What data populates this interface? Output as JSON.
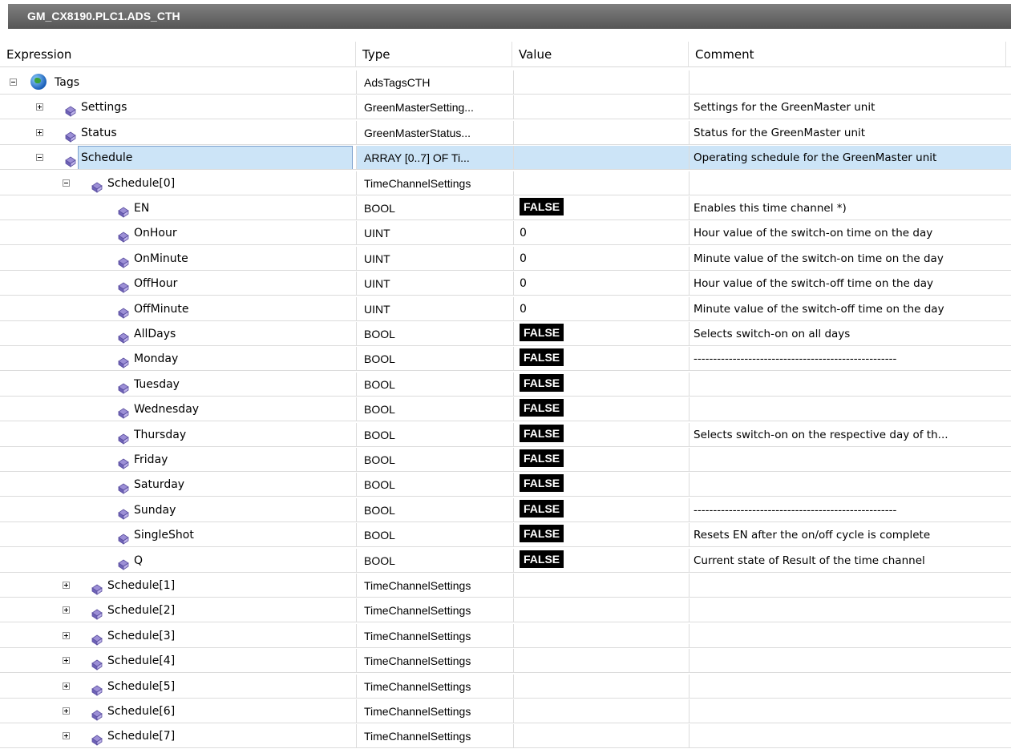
{
  "window": {
    "title": "GM_CX8190.PLC1.ADS_CTH"
  },
  "columns": {
    "expression": "Expression",
    "type": "Type",
    "value": "Value",
    "comment": "Comment"
  },
  "colors": {
    "selection": "#cce4f7",
    "titlebar": "#666666",
    "value_bg": "#000000"
  },
  "rows": [
    {
      "name": "Tags",
      "level": 0,
      "toggle": "minus",
      "icon": "globe-icon",
      "type": "AdsTagsCTH",
      "value": "",
      "comment": ""
    },
    {
      "name": "Settings",
      "level": 1,
      "toggle": "plus",
      "icon": "variable-icon",
      "type": "GreenMasterSetting...",
      "value": "",
      "comment": "Settings for the GreenMaster unit"
    },
    {
      "name": "Status",
      "level": 1,
      "toggle": "plus",
      "icon": "variable-icon",
      "type": "GreenMasterStatus...",
      "value": "",
      "comment": "Status for the GreenMaster unit"
    },
    {
      "name": "Schedule",
      "level": 1,
      "toggle": "minus",
      "icon": "variable-icon",
      "type": "ARRAY [0..7] OF Ti...",
      "value": "",
      "comment": "Operating schedule for the GreenMaster unit",
      "selected": true
    },
    {
      "name": "Schedule[0]",
      "level": 2,
      "toggle": "minus",
      "icon": "variable-icon",
      "type": "TimeChannelSettings",
      "value": "",
      "comment": ""
    },
    {
      "name": "EN",
      "level": 3,
      "toggle": "",
      "icon": "variable-icon",
      "type": "BOOL",
      "value": "FALSE",
      "comment": "Enables this time channel *)"
    },
    {
      "name": "OnHour",
      "level": 3,
      "toggle": "",
      "icon": "variable-icon",
      "type": "UINT",
      "value": "0",
      "comment": "Hour value of the switch-on time on the day"
    },
    {
      "name": "OnMinute",
      "level": 3,
      "toggle": "",
      "icon": "variable-icon",
      "type": "UINT",
      "value": "0",
      "comment": "Minute value of the switch-on time on the day"
    },
    {
      "name": "OffHour",
      "level": 3,
      "toggle": "",
      "icon": "variable-icon",
      "type": "UINT",
      "value": "0",
      "comment": "Hour value of the switch-off time on the day"
    },
    {
      "name": "OffMinute",
      "level": 3,
      "toggle": "",
      "icon": "variable-icon",
      "type": "UINT",
      "value": "0",
      "comment": "Minute value of the switch-off time on the day"
    },
    {
      "name": "AllDays",
      "level": 3,
      "toggle": "",
      "icon": "variable-icon",
      "type": "BOOL",
      "value": "FALSE",
      "comment": "Selects switch-on on all days"
    },
    {
      "name": "Monday",
      "level": 3,
      "toggle": "",
      "icon": "variable-icon",
      "type": "BOOL",
      "value": "FALSE",
      "comment": "----------------------------------------------------"
    },
    {
      "name": "Tuesday",
      "level": 3,
      "toggle": "",
      "icon": "variable-icon",
      "type": "BOOL",
      "value": "FALSE",
      "comment": ""
    },
    {
      "name": "Wednesday",
      "level": 3,
      "toggle": "",
      "icon": "variable-icon",
      "type": "BOOL",
      "value": "FALSE",
      "comment": ""
    },
    {
      "name": "Thursday",
      "level": 3,
      "toggle": "",
      "icon": "variable-icon",
      "type": "BOOL",
      "value": "FALSE",
      "comment": "Selects switch-on on the respective day of th..."
    },
    {
      "name": "Friday",
      "level": 3,
      "toggle": "",
      "icon": "variable-icon",
      "type": "BOOL",
      "value": "FALSE",
      "comment": ""
    },
    {
      "name": "Saturday",
      "level": 3,
      "toggle": "",
      "icon": "variable-icon",
      "type": "BOOL",
      "value": "FALSE",
      "comment": ""
    },
    {
      "name": "Sunday",
      "level": 3,
      "toggle": "",
      "icon": "variable-icon",
      "type": "BOOL",
      "value": "FALSE",
      "comment": "----------------------------------------------------"
    },
    {
      "name": "SingleShot",
      "level": 3,
      "toggle": "",
      "icon": "variable-icon",
      "type": "BOOL",
      "value": "FALSE",
      "comment": "Resets EN after the on/off cycle is complete"
    },
    {
      "name": "Q",
      "level": 3,
      "toggle": "",
      "icon": "variable-icon",
      "type": "BOOL",
      "value": "FALSE",
      "comment": "Current state of Result of the time channel"
    },
    {
      "name": "Schedule[1]",
      "level": 2,
      "toggle": "plus",
      "icon": "variable-icon",
      "type": "TimeChannelSettings",
      "value": "",
      "comment": ""
    },
    {
      "name": "Schedule[2]",
      "level": 2,
      "toggle": "plus",
      "icon": "variable-icon",
      "type": "TimeChannelSettings",
      "value": "",
      "comment": ""
    },
    {
      "name": "Schedule[3]",
      "level": 2,
      "toggle": "plus",
      "icon": "variable-icon",
      "type": "TimeChannelSettings",
      "value": "",
      "comment": ""
    },
    {
      "name": "Schedule[4]",
      "level": 2,
      "toggle": "plus",
      "icon": "variable-icon",
      "type": "TimeChannelSettings",
      "value": "",
      "comment": ""
    },
    {
      "name": "Schedule[5]",
      "level": 2,
      "toggle": "plus",
      "icon": "variable-icon",
      "type": "TimeChannelSettings",
      "value": "",
      "comment": ""
    },
    {
      "name": "Schedule[6]",
      "level": 2,
      "toggle": "plus",
      "icon": "variable-icon",
      "type": "TimeChannelSettings",
      "value": "",
      "comment": ""
    },
    {
      "name": "Schedule[7]",
      "level": 2,
      "toggle": "plus",
      "icon": "variable-icon",
      "type": "TimeChannelSettings",
      "value": "",
      "comment": ""
    }
  ]
}
